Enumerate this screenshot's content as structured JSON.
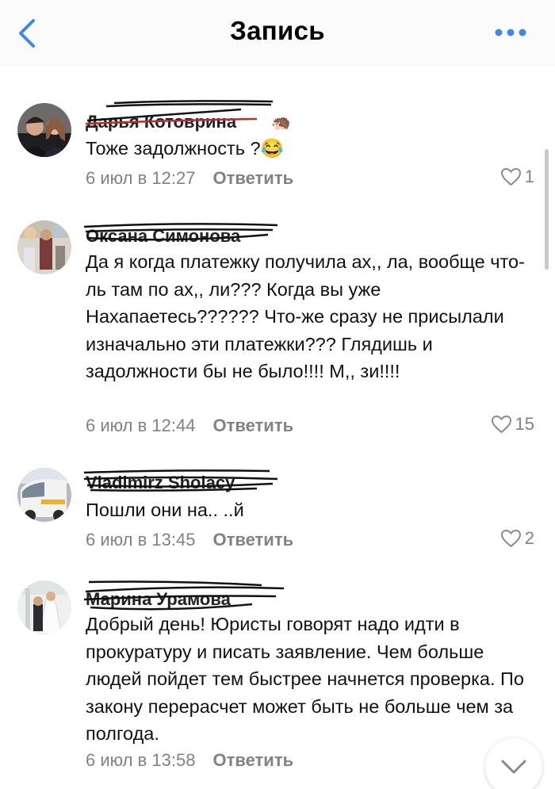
{
  "header": {
    "title": "Запись",
    "back_icon": "chevron-left-icon",
    "more_icon": "more-dots-icon",
    "accent": "#3f8ae0"
  },
  "comments": [
    {
      "name": "Дарья Котоврина",
      "emoji": "🦔",
      "text": "Тоже задолжность ?😂",
      "time": "6 июл в 12:27",
      "reply": "Ответить",
      "likes": "1"
    },
    {
      "name": "Оксана Симонова",
      "text": "Да я когда платежку получила ах,, ла, вообще что-ль там по ах,, ли??? Когда вы уже Нахапаетесь?????? Что-же сразу не присылали изначально эти платежки??? Глядишь и задолжности бы не было!!!! М,, зи!!!!",
      "time": "6 июл в 12:44",
      "reply": "Ответить",
      "likes": "15"
    },
    {
      "name": "Vladimirz Sholacy",
      "text": "Пошли они на.. ..й",
      "time": "6 июл в 13:45",
      "reply": "Ответить",
      "likes": "2"
    },
    {
      "name": "Марина Урамова",
      "text": "Добрый день! Юристы говорят надо идти в прокуратуру и писать заявление. Чем больше людей пойдет тем быстрее начнется проверка. По закону перерасчет может быть не больше чем за полгода.",
      "time": "6 июл в 13:58",
      "reply": "Ответить"
    }
  ],
  "colors": {
    "meta": "#828282",
    "scribble": "#111111",
    "heart": "#8a8a8a"
  },
  "scroll_down_icon": "chevron-down-icon"
}
